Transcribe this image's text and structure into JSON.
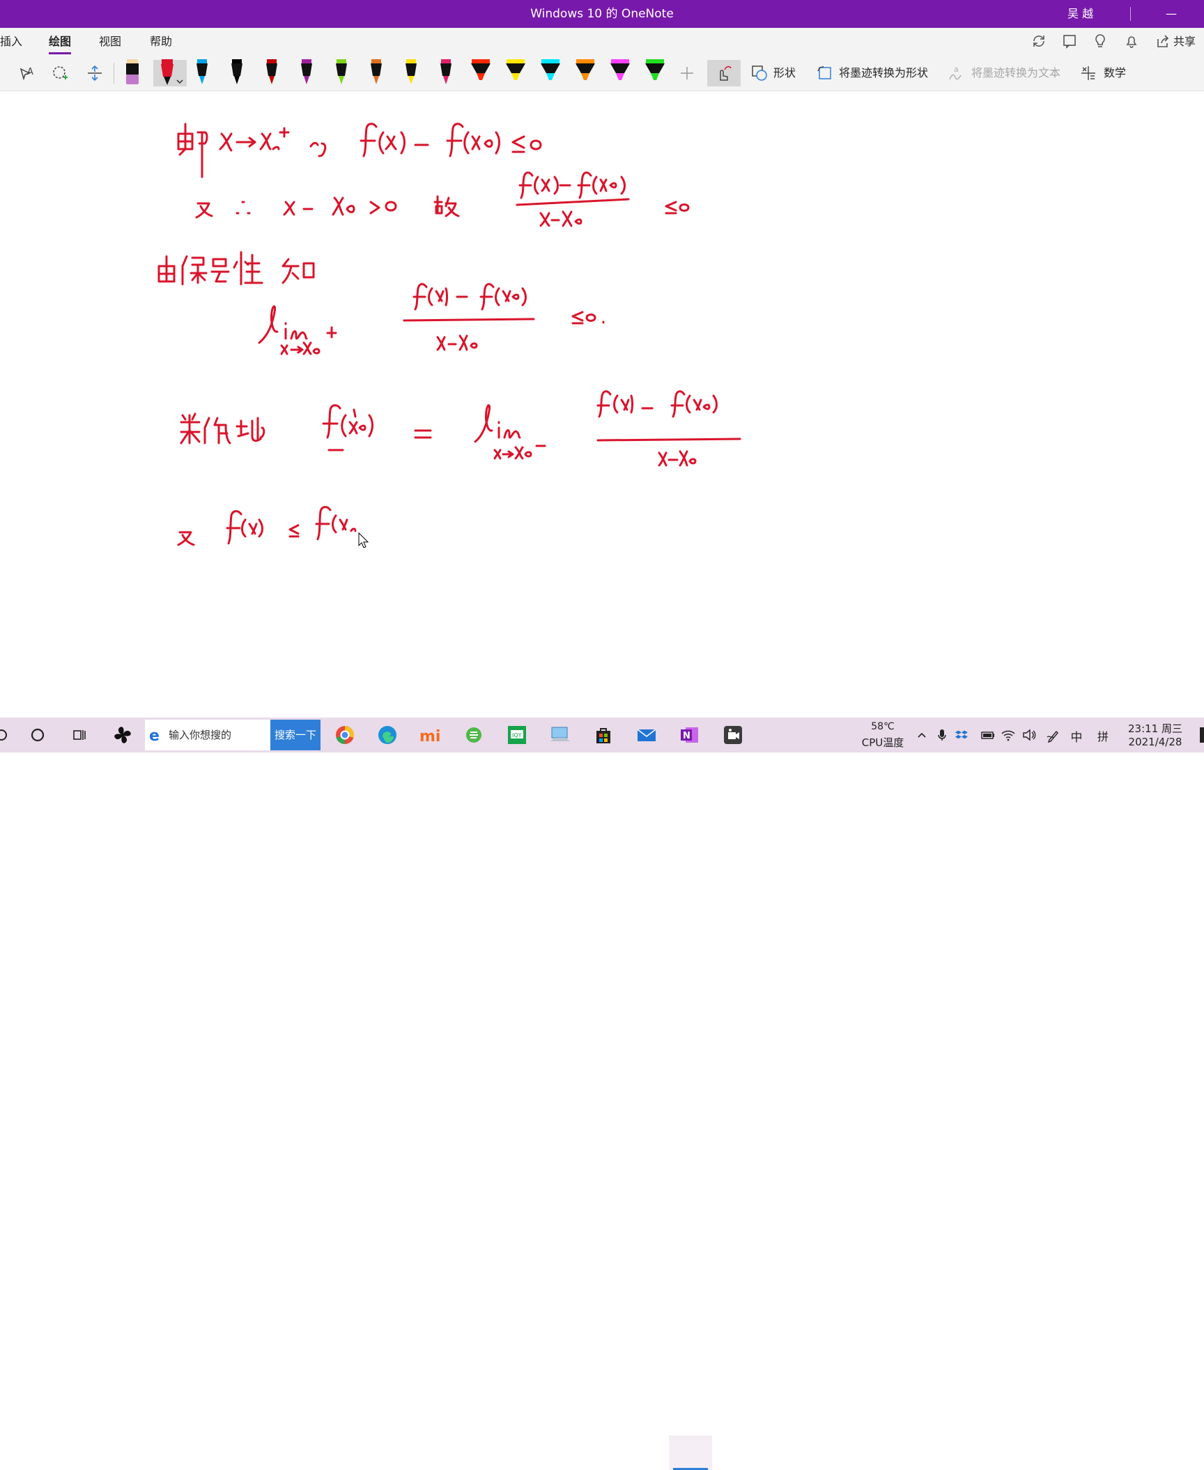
{
  "window": {
    "title": "Windows 10 的 OneNote",
    "user": "吴 越",
    "minimize": "—"
  },
  "menu": {
    "tabs": [
      {
        "label": "插入"
      },
      {
        "label": "绘图"
      },
      {
        "label": "视图"
      },
      {
        "label": "帮助"
      }
    ],
    "active_tab": "绘图",
    "share_label": "共享"
  },
  "toolbar": {
    "shapes_label": "形状",
    "ink_to_shape_label": "将墨迹转换为形状",
    "ink_to_text_label": "将墨迹转换为文本",
    "math_label": "数学",
    "pens": [
      {
        "kind": "highlighter",
        "color": "#c07ac9"
      },
      {
        "kind": "pen",
        "color": "#d9142b",
        "selected": true
      },
      {
        "kind": "pen",
        "color": "#00a2e8"
      },
      {
        "kind": "pen",
        "color": "#000000"
      },
      {
        "kind": "pen",
        "color": "#c00000"
      },
      {
        "kind": "pen",
        "color": "#a020a0"
      },
      {
        "kind": "pen",
        "color": "#7fd41a"
      },
      {
        "kind": "pen",
        "color": "#e07020"
      },
      {
        "kind": "pen",
        "color": "#ffe000"
      },
      {
        "kind": "pen",
        "color": "#e0206a"
      },
      {
        "kind": "highlighter",
        "color": "#ff2a00"
      },
      {
        "kind": "highlighter",
        "color": "#ffe800"
      },
      {
        "kind": "highlighter",
        "color": "#00e5ff"
      },
      {
        "kind": "highlighter",
        "color": "#ff8c00"
      },
      {
        "kind": "highlighter",
        "color": "#ff40ff"
      },
      {
        "kind": "highlighter",
        "color": "#22dd22"
      }
    ]
  },
  "notes": {
    "ink_color": "#d9142b",
    "lines": [
      {
        "text": "即 x→x₀⁺ 时  f(x) − f(x₀) ≤ 0"
      },
      {
        "text": "又 ∵ x − x₀ > 0  故  (f(x) − f(x₀)) / (x − x₀) ≤ 0"
      },
      {
        "text": "由保号性 知"
      },
      {
        "text": "lim x→x₀⁺ (f(x) − f(x₀)) / (x − x₀) ≤ 0."
      },
      {
        "text": "类似地  f′₋(x₀) = lim x→x₀⁻ (f(x) − f(x₀)) / (x − x₀)"
      },
      {
        "text": "又  f(x) ≤ f(x₀)"
      }
    ]
  },
  "taskbar": {
    "search_placeholder": "输入你想搜的",
    "search_button": "搜索一下",
    "cpu_temp": "58℃",
    "cpu_label": "CPU温度",
    "ime_lang": "中",
    "ime_mode": "拼",
    "time": "23:11 周三",
    "date": "2021/4/28",
    "colors": {
      "accent": "#7719aa",
      "taskbar": "#e9dbe9",
      "search_button": "#2f7fd8"
    }
  }
}
